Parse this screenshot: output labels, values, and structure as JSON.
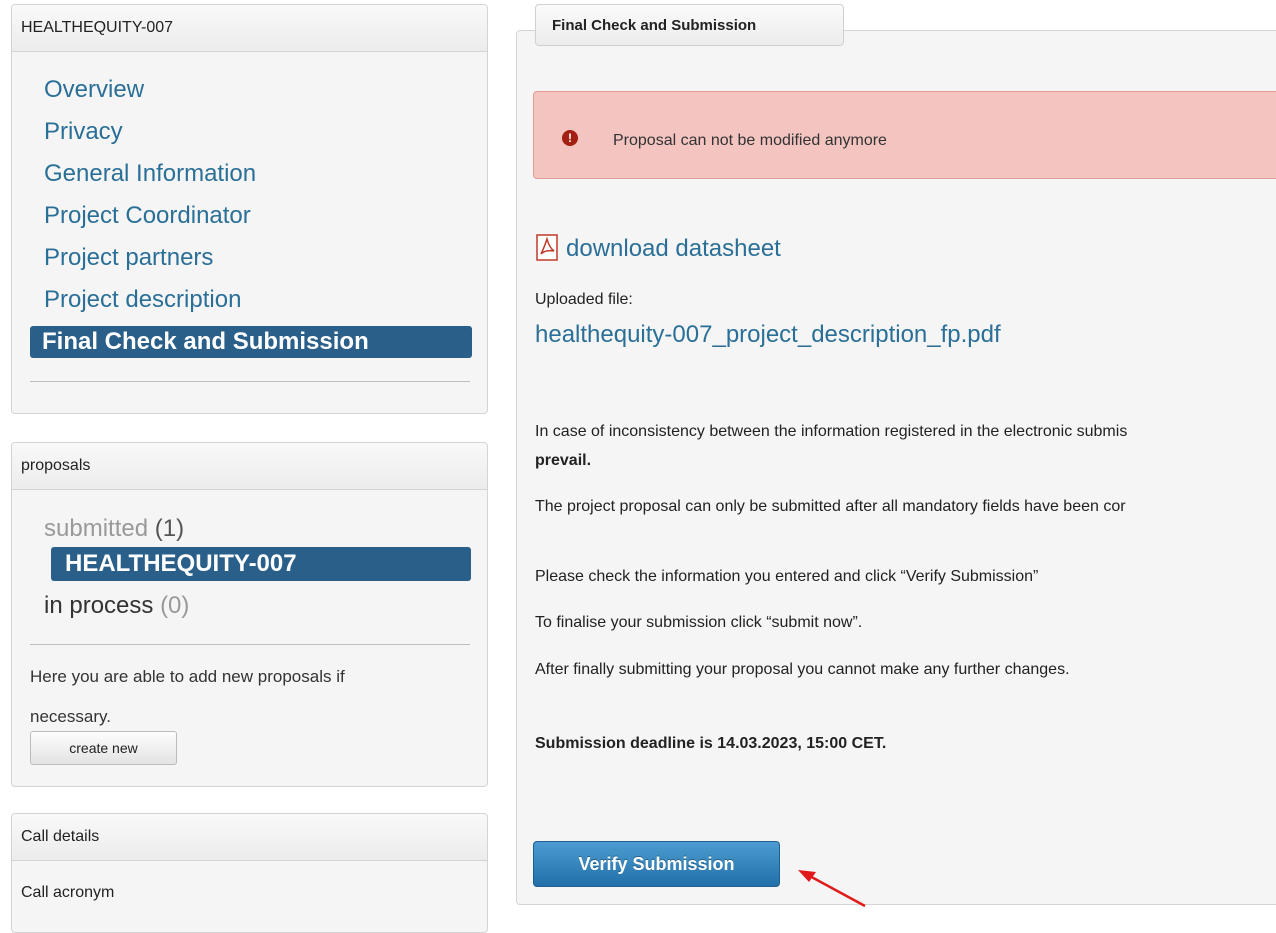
{
  "project_panel": {
    "title": "HEALTHEQUITY-007",
    "nav": [
      {
        "label": "Overview"
      },
      {
        "label": "Privacy"
      },
      {
        "label": "General Information"
      },
      {
        "label": "Project Coordinator"
      },
      {
        "label": "Project partners"
      },
      {
        "label": "Project description"
      },
      {
        "label": "Final Check and Submission",
        "active": true
      }
    ]
  },
  "proposals_panel": {
    "title": "proposals",
    "submitted_label": "submitted",
    "submitted_count": "(1)",
    "submitted_item": "HEALTHEQUITY-007",
    "in_process_label": "in process",
    "in_process_count": "(0)",
    "info_text_line1": "Here you are able to add new proposals if",
    "info_text_line2": "necessary.",
    "create_button": "create new"
  },
  "call_panel": {
    "title": "Call details",
    "call_acronym_label": "Call acronym"
  },
  "main": {
    "tab_title": "Final Check and Submission",
    "alert": {
      "icon": "exclamation-circle-icon",
      "color": "#f3c4c0",
      "text": "Proposal can not be modified anymore"
    },
    "download_link": "download datasheet",
    "uploaded_label": "Uploaded file:",
    "uploaded_file": "healthequity-007_project_description_fp.pdf",
    "inconsistency_text": "In case of inconsistency between the information registered in the electronic submis",
    "prevail_text": "prevail.",
    "mandatory_text": "The project proposal can only be submitted after all mandatory fields have been cor",
    "check_text": "Please check the information you entered and click “Verify Submission”",
    "finalise_text": "To finalise your submission click “submit now”.",
    "after_text": "After finally submitting your proposal you cannot make any further changes.",
    "deadline_text": "Submission deadline is 14.03.2023, 15:00 CET.",
    "verify_button": "Verify Submission"
  },
  "colors": {
    "accent": "#2a5f8a",
    "link": "#2a6f97",
    "button": "#2270a9",
    "annotation_arrow": "#e11a1a"
  }
}
